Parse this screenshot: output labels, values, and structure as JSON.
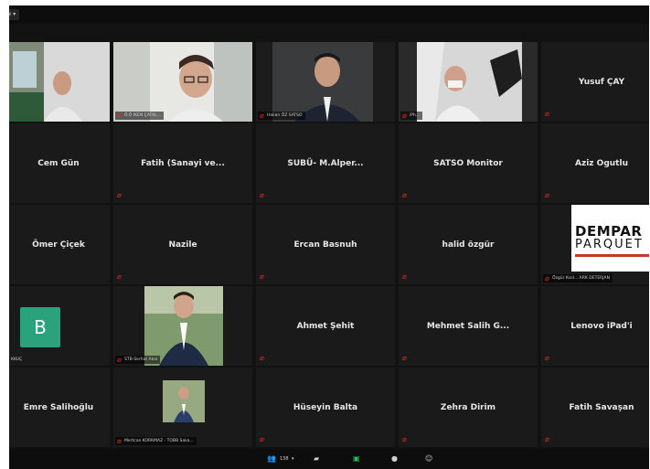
{
  "topbar": {
    "view_label": "iew ▾"
  },
  "toolbar": {
    "participants_count": "138",
    "chevron": "▾"
  },
  "tiles": [
    {
      "name": "",
      "label": ""
    },
    {
      "name": "",
      "label": "Ö.Ö İKEN ÇATAL..."
    },
    {
      "name": "",
      "label": "Hakan ÖZ SATSO"
    },
    {
      "name": "",
      "label": "iPh..."
    },
    {
      "name": "Yusuf ÇAY",
      "label": ""
    },
    {
      "name": "Cem Gün",
      "label": ""
    },
    {
      "name": "Fatih (Sanayi ve...",
      "label": ""
    },
    {
      "name": "SUBÜ- M.Alper...",
      "label": ""
    },
    {
      "name": "SATSO Monitor",
      "label": ""
    },
    {
      "name": "Aziz Ogutlu",
      "label": ""
    },
    {
      "name": "Ömer Çiçek",
      "label": ""
    },
    {
      "name": "Nazile",
      "label": ""
    },
    {
      "name": "Ercan Basnuh",
      "label": ""
    },
    {
      "name": "halid özgür",
      "label": ""
    },
    {
      "name": "",
      "label": "Özgür Kızıl... ARK DETERJAN"
    },
    {
      "name": "",
      "label": "KKUÇ"
    },
    {
      "name": "",
      "label": "STB-Serhat Akal"
    },
    {
      "name": "Ahmet Şehit",
      "label": ""
    },
    {
      "name": "Mehmet Salih G...",
      "label": ""
    },
    {
      "name": "Lenovo iPad'i",
      "label": ""
    },
    {
      "name": "Emre Salihoğlu",
      "label": ""
    },
    {
      "name": "",
      "label": "Mertcan KORKMAZ - TOBB Saka..."
    },
    {
      "name": "Hüseyin Balta",
      "label": ""
    },
    {
      "name": "Zehra Dirim",
      "label": ""
    },
    {
      "name": "Fatih Savaşan",
      "label": ""
    }
  ],
  "avatar_letter": "B",
  "logo": {
    "line1": "DEMPAR",
    "line2": "PARQUET"
  },
  "colors": {
    "mic_muted": "#e02b2b",
    "avatar_green": "#2aa37c"
  }
}
